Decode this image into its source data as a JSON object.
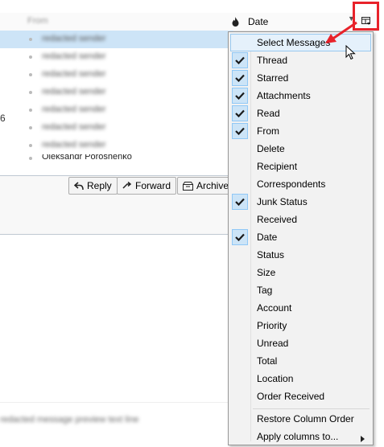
{
  "thread_pane": {
    "header": {
      "from_label": "From",
      "date_label": "Date",
      "junk_icon": "flame-icon",
      "sort_icon": "sort-caret-icon",
      "column_picker_icon": "column-picker-icon"
    },
    "rows": [
      {
        "text": "redacted sender",
        "selected": true
      },
      {
        "text": "redacted sender",
        "selected": false
      },
      {
        "text": "redacted sender",
        "selected": false
      },
      {
        "text": "redacted sender",
        "selected": false
      },
      {
        "text": "redacted sender",
        "selected": false
      },
      {
        "text": "redacted sender",
        "selected": false
      },
      {
        "text": "redacted sender",
        "selected": false
      },
      {
        "text": "Oleksandr Poroshenko",
        "selected": false
      }
    ],
    "edge_digit": "6"
  },
  "message_toolbar": {
    "reply": "Reply",
    "forward": "Forward",
    "archive": "Archive"
  },
  "preview_text": "redacted message preview text line",
  "column_menu": {
    "select_messages": "Select Messages",
    "items": [
      {
        "label": "Thread",
        "checked": true
      },
      {
        "label": "Starred",
        "checked": true
      },
      {
        "label": "Attachments",
        "checked": true
      },
      {
        "label": "Read",
        "checked": true
      },
      {
        "label": "From",
        "checked": true
      },
      {
        "label": "Delete",
        "checked": false
      },
      {
        "label": "Recipient",
        "checked": false
      },
      {
        "label": "Correspondents",
        "checked": false
      },
      {
        "label": "Junk Status",
        "checked": true
      },
      {
        "label": "Received",
        "checked": false
      },
      {
        "label": "Date",
        "checked": true
      },
      {
        "label": "Status",
        "checked": false
      },
      {
        "label": "Size",
        "checked": false
      },
      {
        "label": "Tag",
        "checked": false
      },
      {
        "label": "Account",
        "checked": false
      },
      {
        "label": "Priority",
        "checked": false
      },
      {
        "label": "Unread",
        "checked": false
      },
      {
        "label": "Total",
        "checked": false
      },
      {
        "label": "Location",
        "checked": false
      },
      {
        "label": "Order Received",
        "checked": false
      }
    ],
    "restore_column_order": "Restore Column Order",
    "apply_columns_to": "Apply columns to..."
  },
  "annotation": {
    "color": "#e8222a"
  }
}
